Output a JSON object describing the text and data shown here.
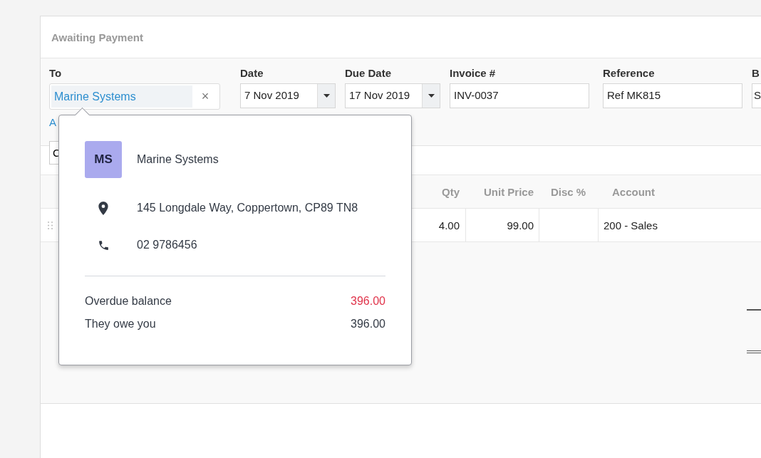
{
  "header": {
    "title": "Awaiting Payment"
  },
  "fields": [
    {
      "kind": "contact",
      "label": "To",
      "value": "Marine Systems",
      "clear": "×"
    },
    {
      "kind": "date",
      "label": "Date",
      "value": "7 Nov 2019"
    },
    {
      "kind": "date",
      "label": "Due Date",
      "value": "17 Nov 2019"
    },
    {
      "kind": "text",
      "label": "Invoice #",
      "value": "INV-0037"
    },
    {
      "kind": "text",
      "label": "Reference",
      "value": "Ref MK815"
    },
    {
      "kind": "text",
      "label": "B",
      "value": "S"
    }
  ],
  "link": "A",
  "button": "C",
  "table": {
    "columns": [
      "Qty",
      "Unit Price",
      "Disc %",
      "Account"
    ],
    "rows": [
      {
        "qty": "4.00",
        "unit_price": "99.00",
        "account": "200 - Sales"
      }
    ]
  },
  "popover": {
    "initials": "MS",
    "name": "Marine Systems",
    "address": "145 Longdale Way, Coppertown, CP89 TN8",
    "phone": "02 9786456",
    "balances": [
      {
        "label": "Overdue balance",
        "value": "396.00",
        "overdue": true
      },
      {
        "label": "They owe you",
        "value": "396.00",
        "overdue": false
      }
    ]
  }
}
